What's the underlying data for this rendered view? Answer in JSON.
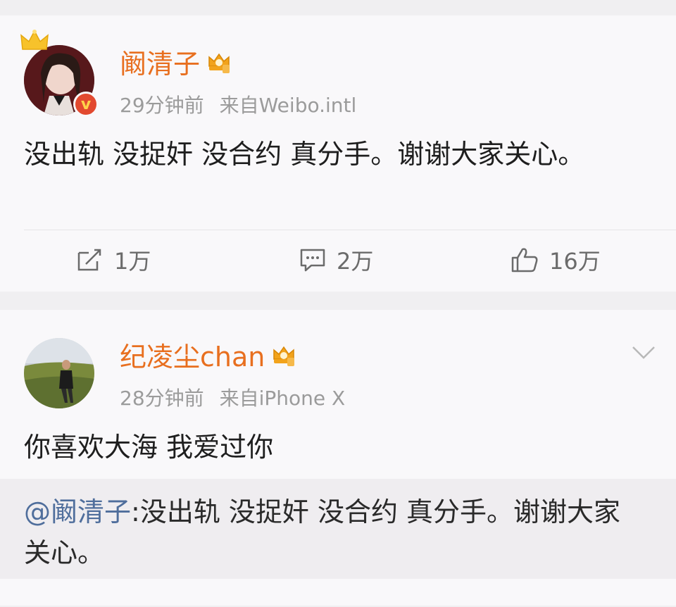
{
  "posts": [
    {
      "username": "阚清子",
      "time": "29分钟前",
      "source": "来自Weibo.intl",
      "content": "没出轨 没捉奸 没合约 真分手。谢谢大家关心。",
      "verified_badge": "v",
      "actions": {
        "repost": "1万",
        "comment": "2万",
        "like": "16万"
      }
    },
    {
      "username": "纪凌尘chan",
      "time": "28分钟前",
      "source": "来自iPhone X",
      "content": "你喜欢大海 我爱过你",
      "quote": {
        "mention": "@阚清子",
        "text": ":没出轨 没捉奸 没合约 真分手。谢谢大家关心。"
      }
    }
  ],
  "icons": [
    "crown-icon",
    "vip-crown-icon",
    "verified-icon",
    "repost-icon",
    "comment-icon",
    "like-icon",
    "chevron-down-icon"
  ],
  "colors": {
    "username": "#e86f1f",
    "mention": "#4f6e9c",
    "meta": "#9b9b9b",
    "badge": "#e2492f"
  }
}
